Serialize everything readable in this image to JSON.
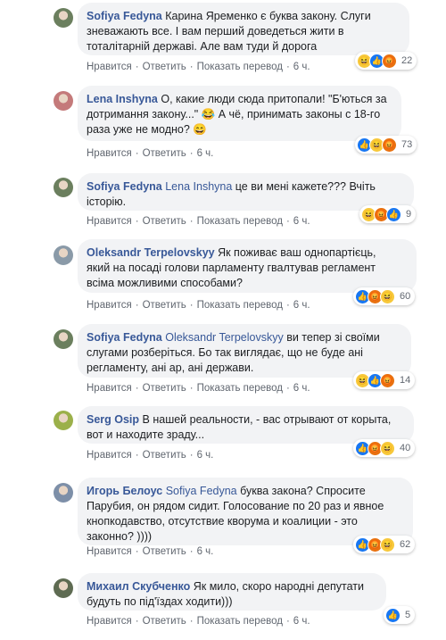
{
  "comments": [
    {
      "author": "Sofiya Fedyna",
      "mention": "",
      "lines": [
        "Карина Яременко є буква закону. Слуги",
        "зневажають все. І вам перший доведеться жити в",
        "тоталітарній державі. Але вам туди й дорога"
      ],
      "actions": {
        "like": "Нравится",
        "reply": "Ответить",
        "translate": "Показать перевод",
        "time": "6 ч."
      },
      "reactions": [
        "haha",
        "like",
        "angry"
      ],
      "count": "22"
    },
    {
      "author": "Lena Inshyna",
      "mention": "",
      "lines": [
        "О, какие люди сюда притопали! \"Б'ються за",
        "дотримання закону...\" 😂 А чё, принимать законы с 18-го",
        "раза уже не модно? 😄"
      ],
      "actions": {
        "like": "Нравится",
        "reply": "Ответить",
        "time": "6 ч."
      },
      "reactions": [
        "like",
        "haha",
        "angry"
      ],
      "count": "73"
    },
    {
      "author": "Sofiya Fedyna",
      "mention": "",
      "lines": [
        "Lena Inshyna це ви мені кажете??? Вчіть",
        "історію."
      ],
      "actions": {
        "like": "Нравится",
        "reply": "Ответить",
        "translate": "Показать перевод",
        "time": "6 ч."
      },
      "reactions": [
        "haha",
        "angry",
        "like"
      ],
      "count": "9"
    },
    {
      "author": "Oleksandr Terpelovskyy",
      "mention": "",
      "lines": [
        "Як поживає ваш однопартієць,",
        "який на посаді голови парламенту гвалтував регламент",
        "всіма можливими способами?"
      ],
      "actions": {
        "like": "Нравится",
        "reply": "Ответить",
        "translate": "Показать перевод",
        "time": "6 ч."
      },
      "reactions": [
        "like",
        "angry",
        "haha"
      ],
      "count": "60"
    },
    {
      "author": "Sofiya Fedyna",
      "mention": "Oleksandr Terpelovskyy",
      "lines": [
        "ви тепер зі своїми",
        "слугами розберіться. Бо так виглядає, що не буде ані",
        "регламенту, ані ар, ані держави."
      ],
      "actions": {
        "like": "Нравится",
        "reply": "Ответить",
        "translate": "Показать перевод",
        "time": "6 ч."
      },
      "reactions": [
        "haha",
        "like",
        "angry"
      ],
      "count": "14"
    },
    {
      "author": "Serg Osip",
      "mention": "",
      "lines": [
        "В нашей реальности, - вас отрывают от корыта,",
        "вот и находите зраду..."
      ],
      "actions": {
        "like": "Нравится",
        "reply": "Ответить",
        "time": "6 ч."
      },
      "reactions": [
        "like",
        "angry",
        "haha"
      ],
      "count": "40"
    },
    {
      "author": "Игорь Белоус",
      "mention": "Sofiya Fedyna",
      "lines": [
        "буква закона? Спросите",
        "Парубия, он рядом сидит. Голосование по 20 раз и явное",
        "кнопкодавство, отсутствие кворума и коалиции - это",
        "законно? ))))"
      ],
      "actions": {
        "like": "Нравится",
        "reply": "Ответить",
        "time": "6 ч."
      },
      "reactions": [
        "like",
        "angry",
        "haha"
      ],
      "count": "62"
    },
    {
      "author": "Михаил Скубченко",
      "mention": "",
      "lines": [
        "Як мило, скоро народні депутати",
        "будуть по під'їздах ходити)))"
      ],
      "actions": {
        "like": "Нравится",
        "reply": "Ответить",
        "translate": "Показать перевод",
        "time": "6 ч."
      },
      "reactions": [
        "like"
      ],
      "count": "5"
    }
  ],
  "avatar_colors": [
    "#6b7f5e",
    "#c47a7a",
    "#6b7f5e",
    "#8a9aa8",
    "#6b7f5e",
    "#9bb04a",
    "#7d8fa8",
    "#5e6b52"
  ]
}
